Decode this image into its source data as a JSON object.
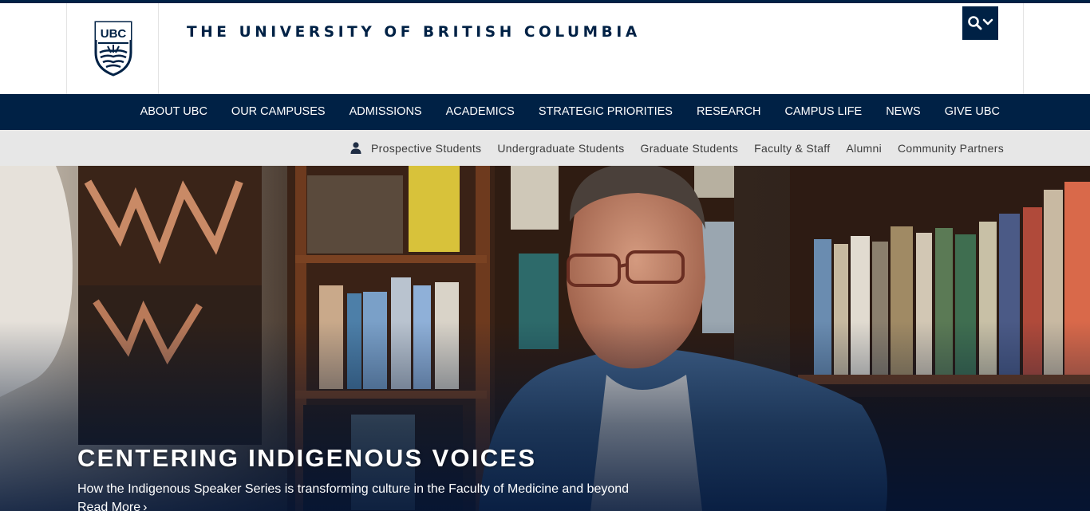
{
  "brand": {
    "logo_text": "UBC",
    "title": "THE UNIVERSITY OF BRITISH COLUMBIA",
    "color": "#002145"
  },
  "search": {
    "icon": "search-icon",
    "toggle_icon": "chevron-down-icon"
  },
  "primary_nav": {
    "items": [
      {
        "label": "ABOUT UBC"
      },
      {
        "label": "OUR CAMPUSES"
      },
      {
        "label": "ADMISSIONS"
      },
      {
        "label": "ACADEMICS"
      },
      {
        "label": "STRATEGIC PRIORITIES"
      },
      {
        "label": "RESEARCH"
      },
      {
        "label": "CAMPUS LIFE"
      },
      {
        "label": "NEWS"
      },
      {
        "label": "GIVE UBC"
      }
    ]
  },
  "audience_nav": {
    "icon": "person-icon",
    "items": [
      {
        "label": "Prospective Students"
      },
      {
        "label": "Undergraduate Students"
      },
      {
        "label": "Graduate Students"
      },
      {
        "label": "Faculty & Staff"
      },
      {
        "label": "Alumni"
      },
      {
        "label": "Community Partners"
      }
    ]
  },
  "hero": {
    "title": "CENTERING INDIGENOUS VOICES",
    "subtitle": "How the Indigenous Speaker Series is transforming culture in the Faculty of Medicine and beyond",
    "link_label": "Read More",
    "link_icon": "chevron-right-icon"
  }
}
